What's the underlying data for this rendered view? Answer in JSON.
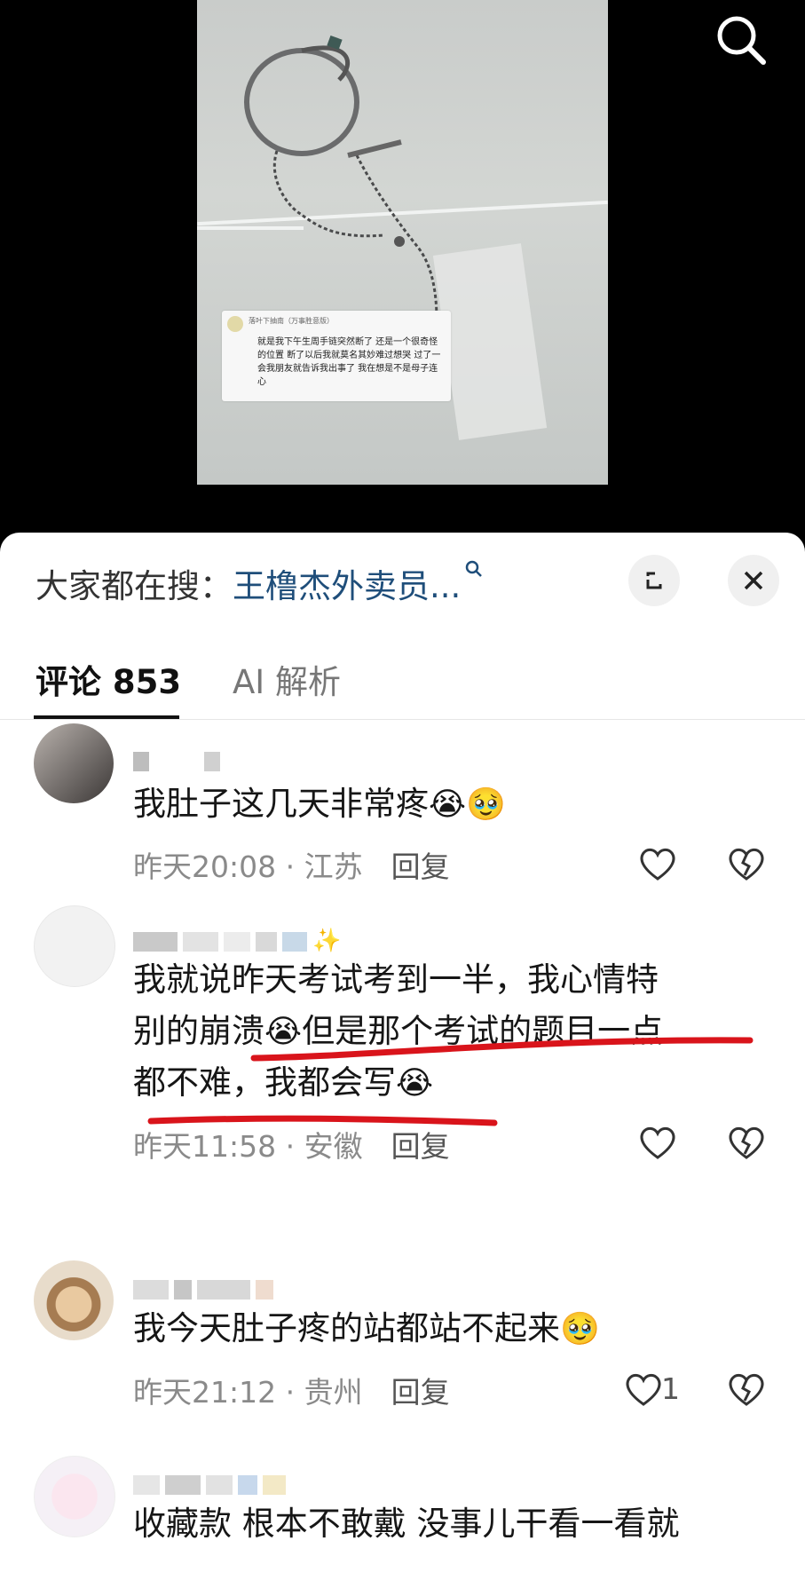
{
  "video": {
    "overlay": {
      "head": "落叶下抽南（万事胜意版）",
      "text": "就是我下午生周手链突然断了 还是一个很奇怪的位置 断了以后我就莫名其妙难过想哭 过了一会我朋友就告诉我出事了 我在想是不是母子连心"
    }
  },
  "top_bar": {
    "search_icon": "search-icon"
  },
  "panel": {
    "hot_search_label": "大家都在搜：",
    "hot_search_keyword": "王橹杰外卖员...",
    "expand_icon": "expand-icon",
    "close_icon": "close-icon"
  },
  "tabs": {
    "comments_label": "评论 853",
    "ai_label": "AI 解析"
  },
  "comments": [
    {
      "text": "我肚子这几天非常疼",
      "emojis": "😭🥹",
      "time": "昨天20:08",
      "location": "江苏",
      "reply": "回复",
      "likes": ""
    },
    {
      "text1": "我就说昨天考试考到一半，我心情特",
      "text2": "别的崩溃",
      "text3": "但是那个考试的题目一点",
      "text4": "都不难，我都会写",
      "emoji": "😭",
      "time": "昨天11:58",
      "location": "安徽",
      "reply": "回复",
      "likes": ""
    },
    {
      "text": "我今天肚子疼的站都站不起来",
      "emoji": "🥹",
      "time": "昨天21:12",
      "location": "贵州",
      "reply": "回复",
      "likes": "1"
    },
    {
      "text": "收藏款 根本不敢戴 没事儿干看一看就"
    }
  ],
  "sep": " · "
}
